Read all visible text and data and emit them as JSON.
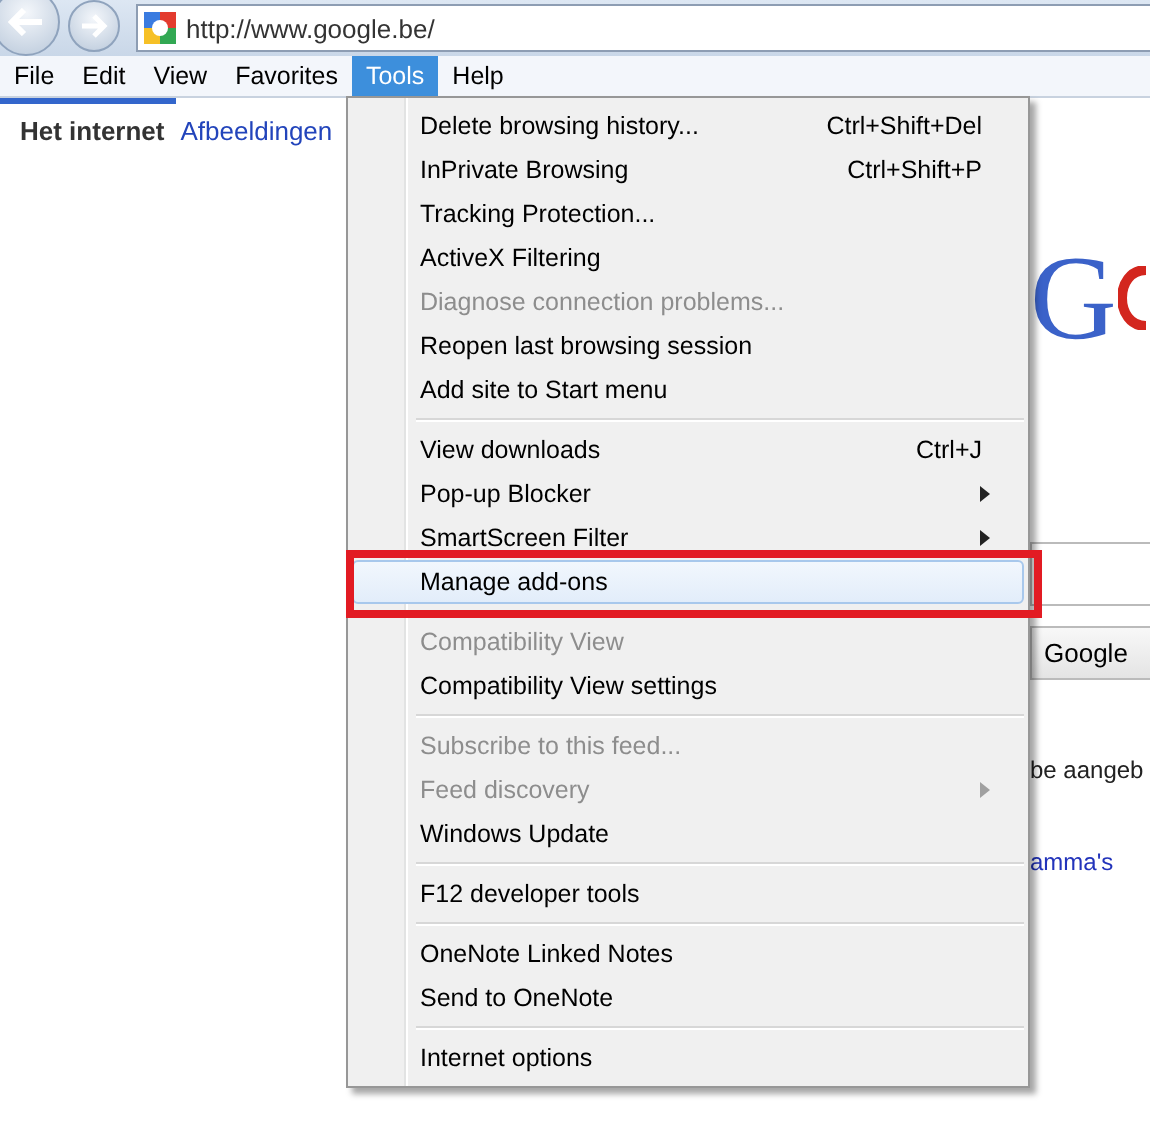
{
  "address_bar": {
    "url": "http://www.google.be/"
  },
  "menu_bar": [
    {
      "label": "File",
      "selected": false
    },
    {
      "label": "Edit",
      "selected": false
    },
    {
      "label": "View",
      "selected": false
    },
    {
      "label": "Favorites",
      "selected": false
    },
    {
      "label": "Tools",
      "selected": true
    },
    {
      "label": "Help",
      "selected": false
    }
  ],
  "page": {
    "nav": [
      {
        "label": "Het internet",
        "selected": true
      },
      {
        "label": "Afbeeldingen",
        "selected": false
      }
    ],
    "logo": "G",
    "search_button": "Google",
    "text": "be aangeb",
    "link": "amma's"
  },
  "tools_menu": [
    [
      {
        "label": "Delete browsing history...",
        "shortcut": "Ctrl+Shift+Del",
        "disabled": false,
        "selected": false
      },
      {
        "label": "InPrivate Browsing",
        "shortcut": "Ctrl+Shift+P",
        "disabled": false,
        "selected": false
      },
      {
        "label": "Tracking Protection...",
        "disabled": false,
        "selected": false
      },
      {
        "label": "ActiveX Filtering",
        "disabled": false,
        "selected": false
      },
      {
        "label": "Diagnose connection problems...",
        "disabled": true,
        "selected": false
      },
      {
        "label": "Reopen last browsing session",
        "disabled": false,
        "selected": false
      },
      {
        "label": "Add site to Start menu",
        "disabled": false,
        "selected": false
      }
    ],
    [
      {
        "label": "View downloads",
        "shortcut": "Ctrl+J",
        "disabled": false,
        "selected": false
      },
      {
        "label": "Pop-up Blocker",
        "disabled": false,
        "submenu": true,
        "selected": false
      },
      {
        "label": "SmartScreen Filter",
        "disabled": false,
        "submenu": true,
        "selected": false
      },
      {
        "label": "Manage add-ons",
        "disabled": false,
        "selected": true,
        "annotated": true
      }
    ],
    [
      {
        "label": "Compatibility View",
        "disabled": true,
        "selected": false
      },
      {
        "label": "Compatibility View settings",
        "disabled": false,
        "selected": false
      }
    ],
    [
      {
        "label": "Subscribe to this feed...",
        "disabled": true,
        "selected": false
      },
      {
        "label": "Feed discovery",
        "disabled": true,
        "submenu": true,
        "selected": false
      },
      {
        "label": "Windows Update",
        "disabled": false,
        "selected": false
      }
    ],
    [
      {
        "label": "F12 developer tools",
        "disabled": false,
        "selected": false
      }
    ],
    [
      {
        "label": "OneNote Linked Notes",
        "disabled": false,
        "selected": false
      },
      {
        "label": "Send to OneNote",
        "disabled": false,
        "selected": false
      }
    ],
    [
      {
        "label": "Internet options",
        "disabled": false,
        "selected": false
      }
    ]
  ]
}
